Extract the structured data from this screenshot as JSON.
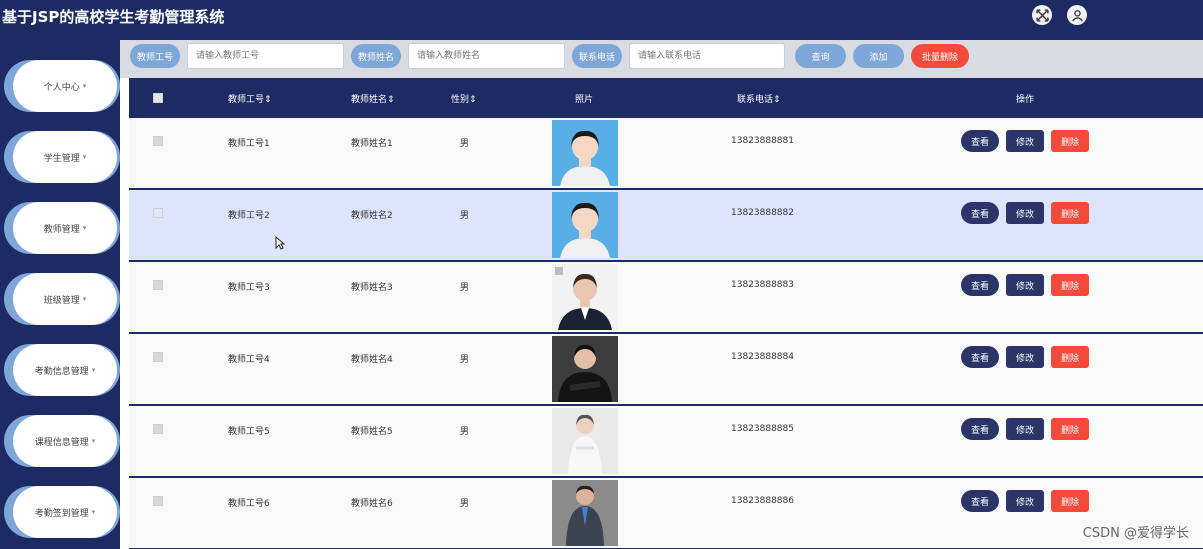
{
  "app": {
    "title": "基于JSP的高校学生考勤管理系统"
  },
  "topbar": {
    "icons": [
      "fullscreen-icon",
      "user-icon"
    ]
  },
  "sidebar": {
    "items": [
      {
        "label": "个人中心"
      },
      {
        "label": "学生管理"
      },
      {
        "label": "教师管理"
      },
      {
        "label": "班级管理"
      },
      {
        "label": "考勤信息管理"
      },
      {
        "label": "课程信息管理"
      },
      {
        "label": "考勤签到管理"
      }
    ]
  },
  "filters": {
    "teacher_no_label": "教师工号",
    "teacher_no_placeholder": "请输入教师工号",
    "teacher_name_label": "教师姓名",
    "teacher_name_placeholder": "请输入教师姓名",
    "phone_label": "联系电话",
    "phone_placeholder": "请输入联系电话",
    "query_label": "查询",
    "add_label": "添加",
    "batch_delete_label": "批量删除"
  },
  "table": {
    "columns": [
      "教师工号",
      "教师姓名",
      "性别",
      "照片",
      "联系电话",
      "操作"
    ],
    "action_labels": {
      "view": "查看",
      "edit": "修改",
      "delete": "删除"
    },
    "rows": [
      {
        "teacher_no": "教师工号1",
        "name": "教师姓名1",
        "gender": "男",
        "phone": "13823888881",
        "photo": "female-portrait-blue",
        "highlighted": false
      },
      {
        "teacher_no": "教师工号2",
        "name": "教师姓名2",
        "gender": "男",
        "phone": "13823888882",
        "photo": "female-portrait-blue",
        "highlighted": true
      },
      {
        "teacher_no": "教师工号3",
        "name": "教师姓名3",
        "gender": "男",
        "phone": "13823888883",
        "photo": "female-portrait-suit",
        "highlighted": false
      },
      {
        "teacher_no": "教师工号4",
        "name": "教师姓名4",
        "gender": "男",
        "phone": "13823888884",
        "photo": "female-portrait-dark",
        "highlighted": false
      },
      {
        "teacher_no": "教师工号5",
        "name": "教师姓名5",
        "gender": "男",
        "phone": "13823888885",
        "photo": "female-portrait-light",
        "highlighted": false
      },
      {
        "teacher_no": "教师工号6",
        "name": "教师姓名6",
        "gender": "男",
        "phone": "13823888886",
        "photo": "male-portrait-suit",
        "highlighted": false
      }
    ]
  },
  "watermark": "CSDN @爱得学长",
  "colors": {
    "primary": "#1e2a63",
    "accent": "#7fa6d8",
    "danger": "#f24b3b",
    "highlight_row": "#dfe4fd"
  }
}
